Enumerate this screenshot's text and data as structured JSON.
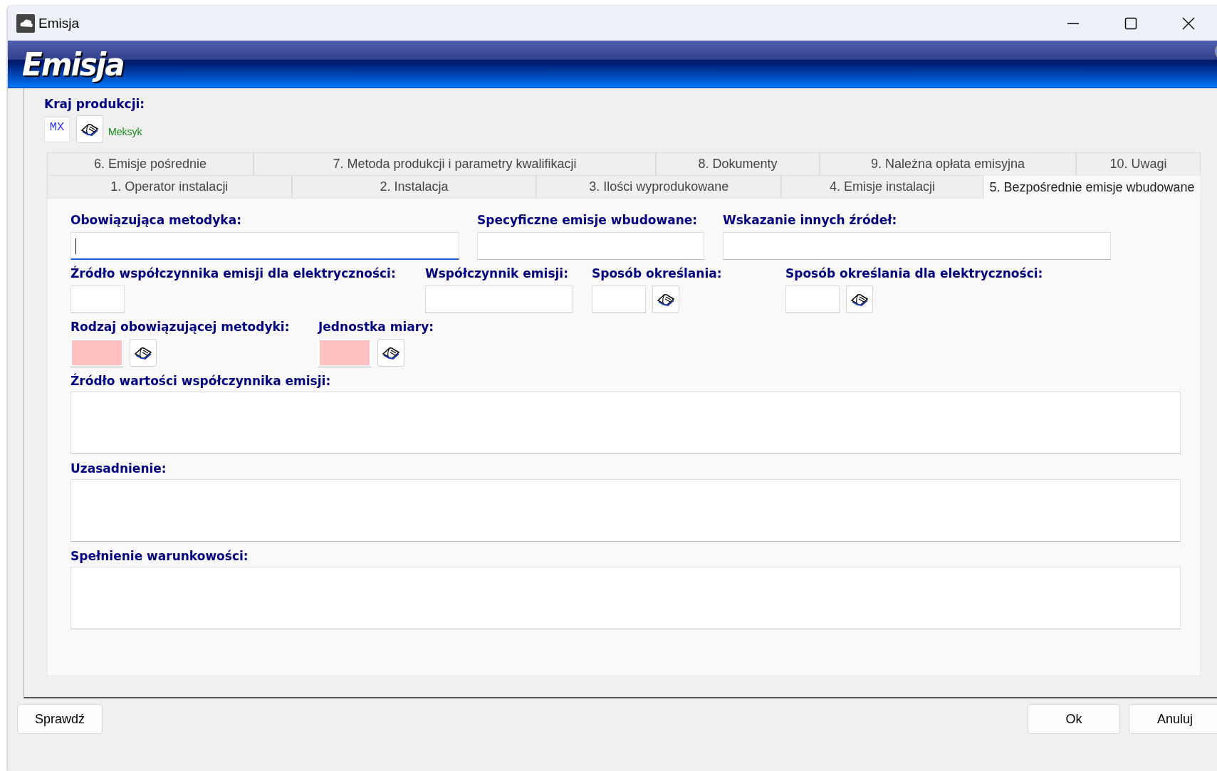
{
  "window": {
    "title": "Emisja"
  },
  "header": {
    "title": "Emisja"
  },
  "country": {
    "label": "Kraj produkcji:",
    "code": "MX",
    "name": "Meksyk"
  },
  "tab_rows": [
    [
      {
        "label": "6. Emisje pośrednie",
        "selected": false
      },
      {
        "label": "7. Metoda  produkcji i parametry kwalifikacji",
        "selected": false
      },
      {
        "label": "8. Dokumenty",
        "selected": false
      },
      {
        "label": "9. Należna opłata emisyjna",
        "selected": false
      },
      {
        "label": "10. Uwagi",
        "selected": false
      }
    ],
    [
      {
        "label": "1. Operator instalacji",
        "selected": false
      },
      {
        "label": "2. Instalacja",
        "selected": false
      },
      {
        "label": "3. Ilości wyprodukowane",
        "selected": false
      },
      {
        "label": "4. Emisje instalacji",
        "selected": false
      },
      {
        "label": "5. Bezpośrednie emisje wbudowane",
        "selected": true
      }
    ]
  ],
  "field_rows": [
    [
      {
        "label": "Obowiązująca metodyka:",
        "kind": "text",
        "focused": true,
        "required": false
      },
      {
        "label": "Specyficzne emisje wbudowane:",
        "kind": "text",
        "focused": false,
        "required": false
      },
      {
        "label": "Wskazanie innych źródeł:",
        "kind": "text",
        "focused": false,
        "required": false
      }
    ],
    [
      {
        "label": "Źródło współczynnika emisji dla elektryczności:",
        "kind": "text",
        "focused": false,
        "required": false
      },
      {
        "label": "Współczynnik emisji:",
        "kind": "text",
        "focused": false,
        "required": false
      },
      {
        "label": "Sposób określania:",
        "kind": "lookup",
        "focused": false,
        "required": false
      },
      {
        "label": "Sposób określania dla elektryczności:",
        "kind": "lookup",
        "focused": false,
        "required": false
      }
    ],
    [
      {
        "label": "Rodzaj obowiązującej metodyki:",
        "kind": "lookup",
        "focused": false,
        "required": true
      },
      {
        "label": "Jednostka miary:",
        "kind": "lookup",
        "focused": false,
        "required": true
      }
    ]
  ],
  "memos": [
    {
      "label": "Źródło wartości współczynnika emisji:"
    },
    {
      "label": "Uzasadnienie:"
    },
    {
      "label": "Spełnienie warunkowości:"
    }
  ],
  "buttons": {
    "left": [
      "Sprawdź"
    ],
    "right": [
      "Ok",
      "Anuluj"
    ]
  }
}
